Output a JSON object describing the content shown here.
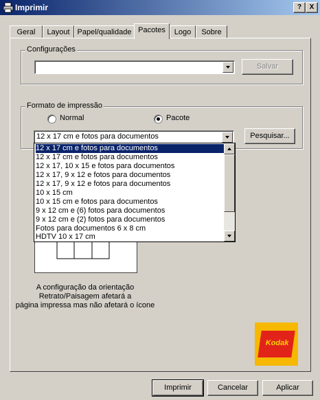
{
  "window": {
    "title": "Imprimir",
    "help_label": "?",
    "close_label": "X"
  },
  "tabs": [
    "Geral",
    "Layout",
    "Papel/qualidade",
    "Pacotes",
    "Logo",
    "Sobre"
  ],
  "active_tab": "Pacotes",
  "configuracoes": {
    "label": "Configurações",
    "value": "",
    "save_label": "Salvar"
  },
  "formato": {
    "label": "Formato de impressão",
    "radio_normal": "Normal",
    "radio_pacote": "Pacote",
    "selected_radio": "Pacote",
    "combo_value": "12 x 17 cm e fotos para documentos",
    "search_label": "Pesquisar...",
    "options": [
      "12 x 17 cm e fotos para documentos",
      "12 x 17 cm e fotos para documentos",
      "12 x 17, 10 x 15 e fotos para documentos",
      "12 x 17, 9 x 12 e fotos para documentos",
      "12 x 17, 9 x 12 e fotos para documentos",
      "10 x 15 cm",
      "10 x 15 cm e fotos para documentos",
      "9 x 12 cm e (6) fotos para documentos",
      "9 x 12 cm e (2) fotos para documentos",
      "Fotos para documentos 6 x 8 cm",
      "HDTV 10 x 17 cm"
    ],
    "selected_index": 0
  },
  "note": {
    "line1": "A configuração da orientação",
    "line2": "Retrato/Paisagem afetará a",
    "line3": "página impressa mas não afetará o ícone"
  },
  "logo": {
    "text": "Kodak"
  },
  "footer": {
    "print_label": "Imprimir",
    "cancel_label": "Cancelar",
    "apply_label": "Aplicar"
  }
}
